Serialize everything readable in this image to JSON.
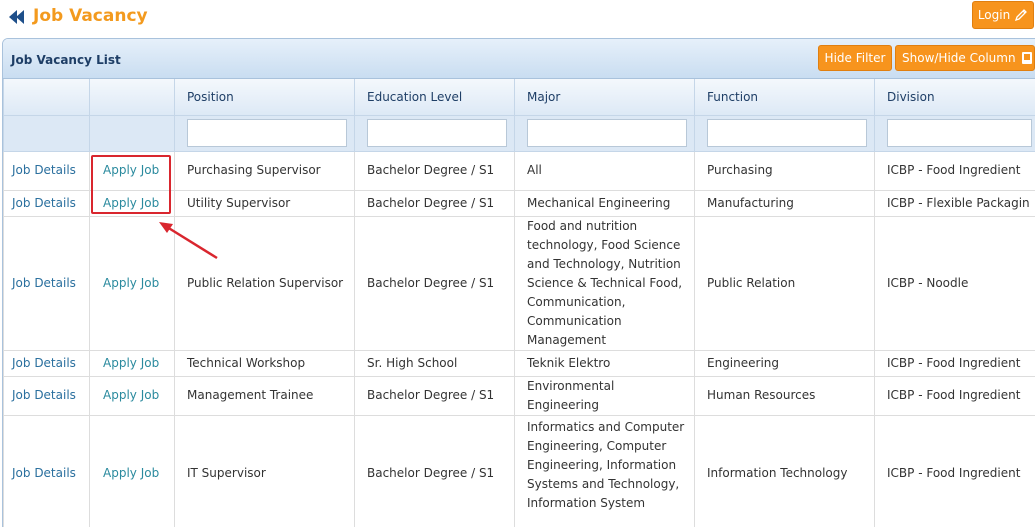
{
  "header": {
    "title": "Job Vacancy",
    "login_label": "Login"
  },
  "panel": {
    "title": "Job Vacancy List",
    "hide_filter_label": "Hide Filter",
    "show_hide_column_label": "Show/Hide Column"
  },
  "table": {
    "columns": [
      "",
      "",
      "Position",
      "Education Level",
      "Major",
      "Function",
      "Division"
    ],
    "filters": [
      "",
      "",
      "",
      "",
      ""
    ],
    "rows": [
      {
        "details": "Job Details",
        "apply": "Apply Job",
        "position": "Purchasing Supervisor",
        "education": "Bachelor Degree / S1",
        "major": "All",
        "function": "Purchasing",
        "division": "ICBP - Food Ingredient"
      },
      {
        "details": "Job Details",
        "apply": "Apply Job",
        "position": "Utility Supervisor",
        "education": "Bachelor Degree / S1",
        "major": "Mechanical Engineering",
        "function": "Manufacturing",
        "division": "ICBP - Flexible Packagin"
      },
      {
        "details": "Job Details",
        "apply": "Apply Job",
        "position": "Public Relation Supervisor",
        "education": "Bachelor Degree / S1",
        "major": "Food and nutrition technology, Food Science and Technology, Nutrition Science & Technical Food, Communication, Communication Management",
        "function": "Public Relation",
        "division": "ICBP - Noodle"
      },
      {
        "details": "Job Details",
        "apply": "Apply Job",
        "position": "Technical Workshop",
        "education": "Sr. High School",
        "major": "Teknik Elektro",
        "function": "Engineering",
        "division": "ICBP - Food Ingredient"
      },
      {
        "details": "Job Details",
        "apply": "Apply Job",
        "position": "Management Trainee",
        "education": "Bachelor Degree / S1",
        "major": "Environmental Engineering",
        "function": "Human Resources",
        "division": "ICBP - Food Ingredient"
      },
      {
        "details": "Job Details",
        "apply": "Apply Job",
        "position": "IT Supervisor",
        "education": "Bachelor Degree / S1",
        "major": "Informatics and Computer Engineering, Computer Engineering, Information Systems and Technology, Information System",
        "function": "Information Technology",
        "division": "ICBP - Food Ingredient"
      }
    ]
  },
  "colors": {
    "accent": "#f7941d",
    "title": "#f39a1e",
    "header_text": "#1e3e66",
    "link": "#2a6f9e",
    "highlight": "#d9262e"
  },
  "icons": {
    "back": "double-chevron-left-icon",
    "login": "pencil-icon",
    "columns": "book-icon"
  }
}
